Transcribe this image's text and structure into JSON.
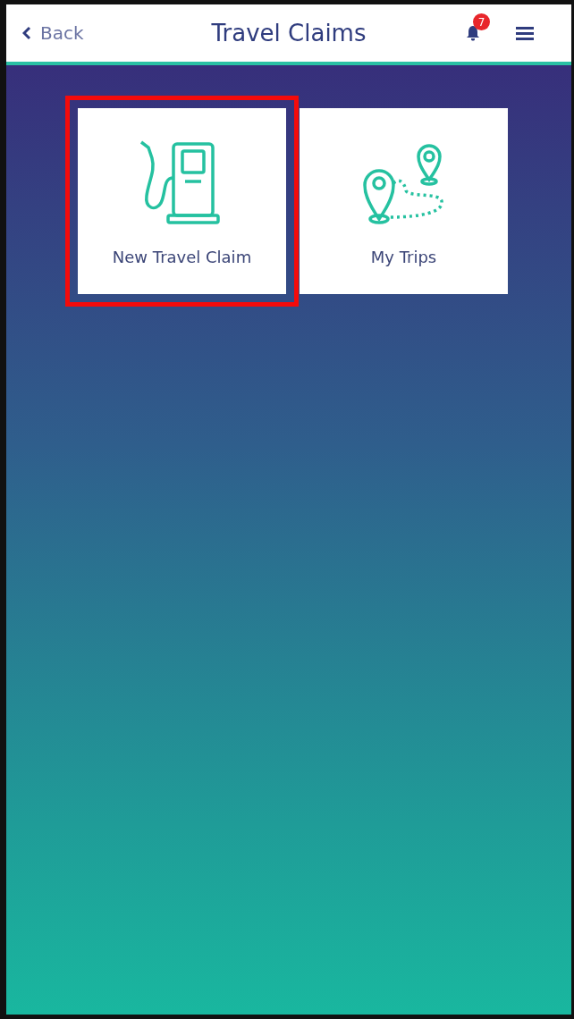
{
  "header": {
    "back": "Back",
    "title": "Travel Claims",
    "notifications": "7"
  },
  "tiles": [
    {
      "kind": "fuel",
      "label": "New Travel Claim",
      "highlighted": true
    },
    {
      "kind": "trips",
      "label": "My Trips",
      "highlighted": false
    }
  ]
}
